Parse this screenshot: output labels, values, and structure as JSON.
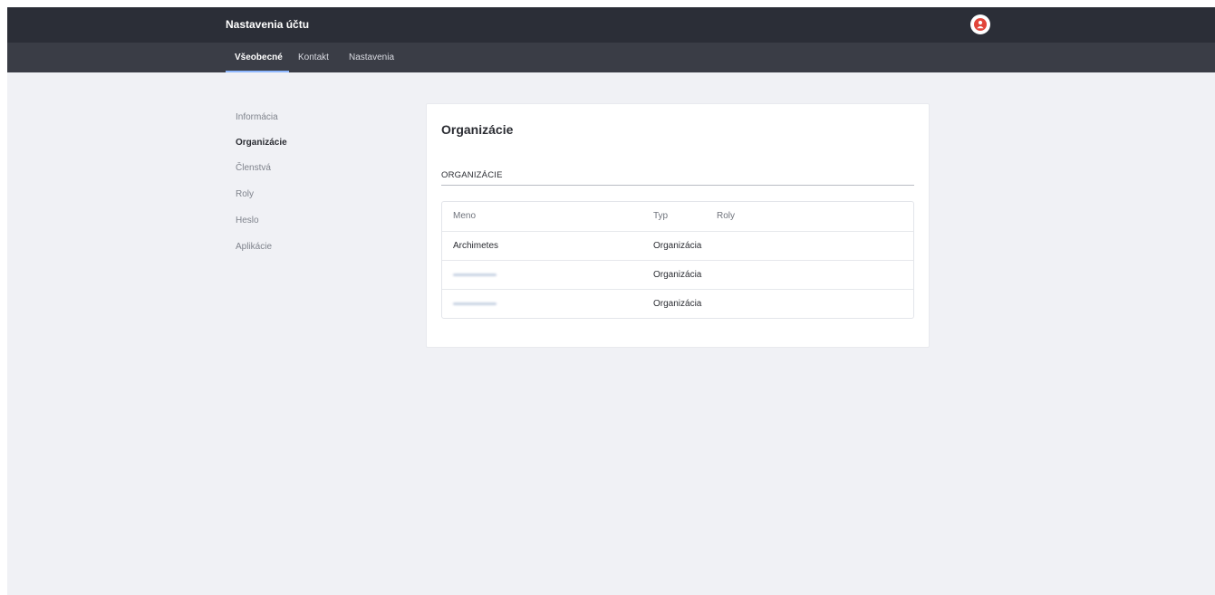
{
  "header": {
    "title": "Nastavenia účtu",
    "avatar_icon": "user-icon",
    "avatar_color": "#e2453a"
  },
  "tabs": [
    {
      "label": "Všeobecné",
      "active": true
    },
    {
      "label": "Kontakt",
      "active": false
    },
    {
      "label": "Nastavenia",
      "active": false
    }
  ],
  "sidebar": {
    "items": [
      {
        "label": "Informácia",
        "active": false
      },
      {
        "label": "Organizácie",
        "active": true
      },
      {
        "label": "Členstvá",
        "active": false
      },
      {
        "label": "Roly",
        "active": false
      },
      {
        "label": "Heslo",
        "active": false
      },
      {
        "label": "Aplikácie",
        "active": false
      }
    ]
  },
  "main": {
    "title": "Organizácie",
    "section_label": "ORGANIZÁCIE",
    "table": {
      "columns": [
        "Meno",
        "Typ",
        "Roly"
      ],
      "rows": [
        {
          "name": "Archimetes",
          "type": "Organizácia",
          "roles": ""
        },
        {
          "name": "",
          "type": "Organizácia",
          "roles": "",
          "name_redacted": true
        },
        {
          "name": "",
          "type": "Organizácia",
          "roles": "",
          "name_redacted": true
        }
      ]
    }
  }
}
